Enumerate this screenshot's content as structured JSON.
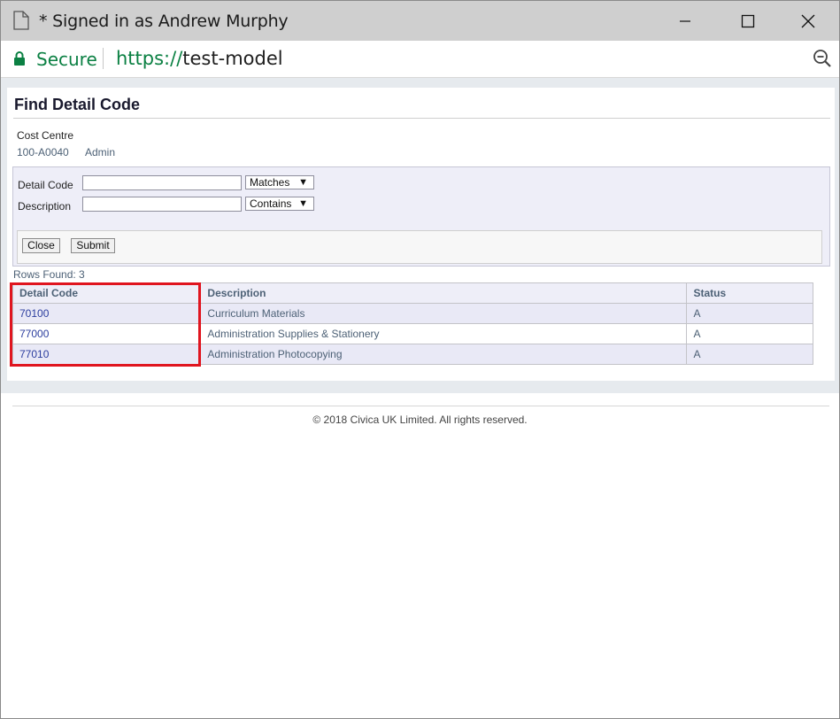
{
  "window": {
    "title": "* Signed in as Andrew Murphy",
    "icons": {
      "document": "document-icon",
      "minimize": "minimize-icon",
      "maximize": "maximize-icon",
      "close": "close-icon"
    }
  },
  "address_bar": {
    "secure_label": "Secure",
    "url_scheme": "https://",
    "url_host": "test-model",
    "icons": {
      "lock": "lock-icon",
      "zoom": "zoom-icon"
    }
  },
  "page": {
    "title": "Find Detail Code",
    "cost_centre": {
      "label": "Cost Centre",
      "code": "100-A0040",
      "name": "Admin"
    },
    "search": {
      "detail_code_label": "Detail Code",
      "detail_code_value": "",
      "detail_code_operator": "Matches",
      "description_label": "Description",
      "description_value": "",
      "description_operator": "Contains",
      "close_label": "Close",
      "submit_label": "Submit"
    },
    "rows_found": "Rows Found: 3",
    "table": {
      "headers": [
        "Detail Code",
        "Description",
        "Status"
      ],
      "rows": [
        {
          "code": "70100",
          "description": "Curriculum Materials",
          "status": "A"
        },
        {
          "code": "77000",
          "description": "Administration Supplies & Stationery",
          "status": "A"
        },
        {
          "code": "77010",
          "description": "Administration Photocopying",
          "status": "A"
        }
      ]
    },
    "footer": "© 2018 Civica UK Limited. All rights reserved."
  },
  "colors": {
    "highlight": "#e0151f",
    "secure_green": "#0b8043",
    "link_blue": "#2b3d9e"
  }
}
